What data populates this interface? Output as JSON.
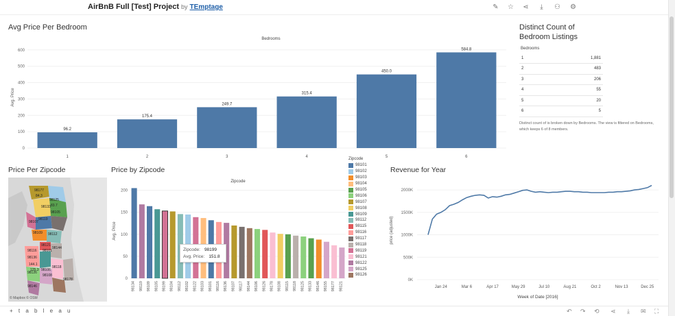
{
  "header": {
    "title": "AirBnB Full [Test] Project",
    "by": "by",
    "author": "TEmptage"
  },
  "avg_price_sheet": {
    "title": "Avg Price Per Bedroom",
    "column_header": "Bedrooms"
  },
  "distinct_count_sheet": {
    "title_line1": "Distinct Count of",
    "title_line2": "Bedroom Listings",
    "column_header": "Bedrooms",
    "rows": [
      {
        "bedrooms": "1",
        "count": "1,881"
      },
      {
        "bedrooms": "2",
        "count": "483"
      },
      {
        "bedrooms": "3",
        "count": "206"
      },
      {
        "bedrooms": "4",
        "count": "55"
      },
      {
        "bedrooms": "5",
        "count": "20"
      },
      {
        "bedrooms": "6",
        "count": "5"
      }
    ],
    "note": "Distinct count of is broken down by Bedrooms. The view is filtered on Bedrooms, which keeps 6 of 8 members."
  },
  "price_per_zipcode_sheet": {
    "title": "Price Per Zipcode",
    "map_labels": [
      "98177",
      "84.3",
      "98125",
      "83.7",
      "98105",
      "98133",
      "98119",
      "98107",
      "98109",
      "98112",
      "98121",
      "98101",
      "98144",
      "98118",
      "98116",
      "98136",
      "98106",
      "98108",
      "98126",
      "98146",
      "144.1",
      "125.3",
      "98178"
    ],
    "copyright": "© Mapbox © OSM"
  },
  "price_by_zipcode_sheet": {
    "title": "Price by Zipcode",
    "column_header": "Zipcode",
    "legend_title": "Zipcode",
    "legend": [
      {
        "zip": "98101",
        "color": "#4e79a7"
      },
      {
        "zip": "98102",
        "color": "#a0cbe8"
      },
      {
        "zip": "98103",
        "color": "#f28e2b"
      },
      {
        "zip": "98104",
        "color": "#ffbe7d"
      },
      {
        "zip": "98105",
        "color": "#59a14f"
      },
      {
        "zip": "98106",
        "color": "#8cd17d"
      },
      {
        "zip": "98107",
        "color": "#b6992d"
      },
      {
        "zip": "98108",
        "color": "#f1ce63"
      },
      {
        "zip": "98109",
        "color": "#499894"
      },
      {
        "zip": "98112",
        "color": "#86bcb6"
      },
      {
        "zip": "98115",
        "color": "#e15759"
      },
      {
        "zip": "98116",
        "color": "#ff9d9a"
      },
      {
        "zip": "98117",
        "color": "#79706e"
      },
      {
        "zip": "98118",
        "color": "#bab0ac"
      },
      {
        "zip": "98119",
        "color": "#d37295"
      },
      {
        "zip": "98121",
        "color": "#fabfd2"
      },
      {
        "zip": "98122",
        "color": "#b07aa1"
      },
      {
        "zip": "98125",
        "color": "#d4a6c8"
      },
      {
        "zip": "98126",
        "color": "#9d7660"
      }
    ],
    "tooltip": {
      "zip_label": "Zipcode:",
      "zip_value": "98199",
      "price_label": "Avg. Price:",
      "price_value": "151.8"
    }
  },
  "revenue_sheet": {
    "title": "Revenue for Year"
  },
  "footer": {
    "logo": "+ t a b l e a u"
  },
  "chart_data": [
    {
      "type": "bar",
      "title": "Avg Price Per Bedroom",
      "xlabel": "Bedrooms",
      "ylabel": "Avg. Price",
      "categories": [
        "1",
        "2",
        "3",
        "4",
        "5",
        "6"
      ],
      "values": [
        96.2,
        175.4,
        249.7,
        315.4,
        450.0,
        584.8
      ],
      "value_labels": [
        "96.2",
        "175.4",
        "249.7",
        "315.4",
        "450.0",
        "584.8"
      ],
      "yticks": [
        "0",
        "100",
        "200",
        "300",
        "400",
        "500",
        "600"
      ],
      "ylim": [
        0,
        620
      ],
      "color": "#4e79a7"
    },
    {
      "type": "bar",
      "title": "Price by Zipcode",
      "xlabel": "Zipcode",
      "ylabel": "Avg. Price",
      "categories": [
        "98134",
        "98119",
        "98109",
        "98105",
        "98199",
        "98104",
        "98112",
        "98102",
        "98122",
        "98103",
        "98101",
        "98116",
        "98136",
        "98107",
        "98117",
        "98144",
        "98106",
        "98126",
        "98178",
        "98108",
        "98115",
        "98118",
        "98125",
        "98133",
        "98146",
        "98155",
        "98177",
        "98121"
      ],
      "values": [
        205,
        168,
        164,
        157,
        153,
        152,
        146,
        145,
        139,
        137,
        132,
        128,
        126,
        120,
        117,
        114,
        112,
        110,
        104,
        101,
        100,
        97,
        95,
        91,
        88,
        83,
        75,
        70
      ],
      "colors": [
        "#4e79a7",
        "#b07aa1",
        "#4e79a7",
        "#499894",
        "#d37295",
        "#b6992d",
        "#86bcb6",
        "#a0cbe8",
        "#d37295",
        "#ffbe7d",
        "#4e79a7",
        "#ff9d9a",
        "#b07aa1",
        "#b6992d",
        "#79706e",
        "#9d7660",
        "#8cd17d",
        "#e15759",
        "#fabfd2",
        "#f1ce63",
        "#59a14f",
        "#bab0ac",
        "#8cd17d",
        "#59a14f",
        "#f28e2b",
        "#d4a6c8",
        "#fabfd2",
        "#d4a6c8"
      ],
      "yticks": [
        "0",
        "50",
        "100",
        "150",
        "200"
      ],
      "ylim": [
        0,
        215
      ],
      "highlighted_index": 4
    },
    {
      "type": "line",
      "title": "Revenue for Year",
      "xlabel": "Week of Date [2016]",
      "ylabel": "price (adjusted)",
      "xticks": [
        "Jan 24",
        "Mar 6",
        "Apr 17",
        "May 29",
        "Jul 10",
        "Aug 21",
        "Oct 2",
        "Nov 13",
        "Dec 25"
      ],
      "yticks": [
        "0K",
        "500K",
        "1000K",
        "1500K",
        "2000K"
      ],
      "ylim": [
        0,
        2200
      ],
      "series": [
        {
          "color": "#4e79a7",
          "x": [
            "Jan 3",
            "Jan 10",
            "Jan 17",
            "Jan 24",
            "Jan 31",
            "Feb 7",
            "Feb 14",
            "Feb 21",
            "Feb 28",
            "Mar 6",
            "Mar 13",
            "Mar 20",
            "Mar 27",
            "Apr 3",
            "Apr 10",
            "Apr 17",
            "Apr 24",
            "May 1",
            "May 8",
            "May 15",
            "May 22",
            "May 29",
            "Jun 5",
            "Jun 12",
            "Jun 19",
            "Jun 26",
            "Jul 3",
            "Jul 10",
            "Jul 17",
            "Jul 24",
            "Jul 31",
            "Aug 7",
            "Aug 14",
            "Aug 21",
            "Aug 28",
            "Sep 4",
            "Sep 11",
            "Sep 18",
            "Sep 25",
            "Oct 2",
            "Oct 9",
            "Oct 16",
            "Oct 23",
            "Oct 30",
            "Nov 6",
            "Nov 13",
            "Nov 20",
            "Nov 27",
            "Dec 4",
            "Dec 11",
            "Dec 18",
            "Dec 25",
            "Jan 1"
          ],
          "values": [
            1000,
            1350,
            1460,
            1500,
            1560,
            1650,
            1680,
            1720,
            1780,
            1830,
            1860,
            1880,
            1890,
            1880,
            1820,
            1850,
            1840,
            1860,
            1890,
            1900,
            1930,
            1960,
            1990,
            2000,
            1970,
            1950,
            1960,
            1950,
            1940,
            1950,
            1950,
            1960,
            1970,
            1970,
            1960,
            1960,
            1950,
            1950,
            1940,
            1940,
            1940,
            1940,
            1950,
            1950,
            1960,
            1960,
            1970,
            1980,
            2000,
            2010,
            2030,
            2050,
            2100
          ]
        }
      ]
    }
  ]
}
